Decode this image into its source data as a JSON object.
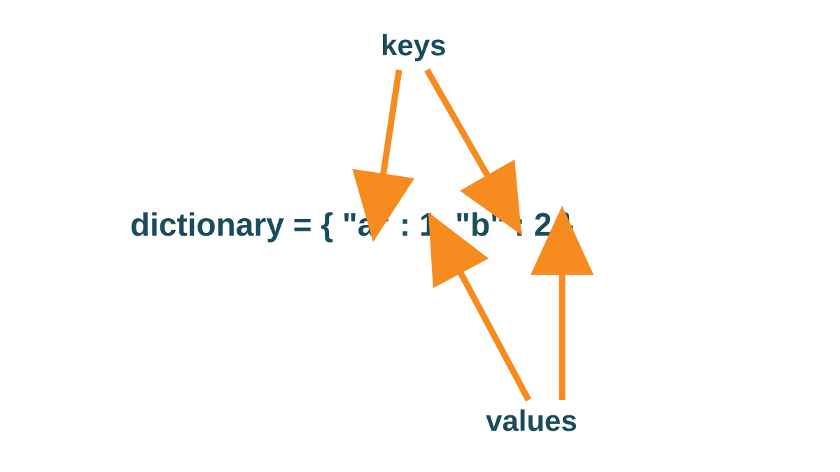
{
  "diagram": {
    "label_keys": "keys",
    "label_values": "values",
    "code": "dictionary = { \"a\" : 1, \"b\" : 2 }"
  },
  "colors": {
    "text": "#1a4d5c",
    "arrow": "#f68b1f"
  }
}
